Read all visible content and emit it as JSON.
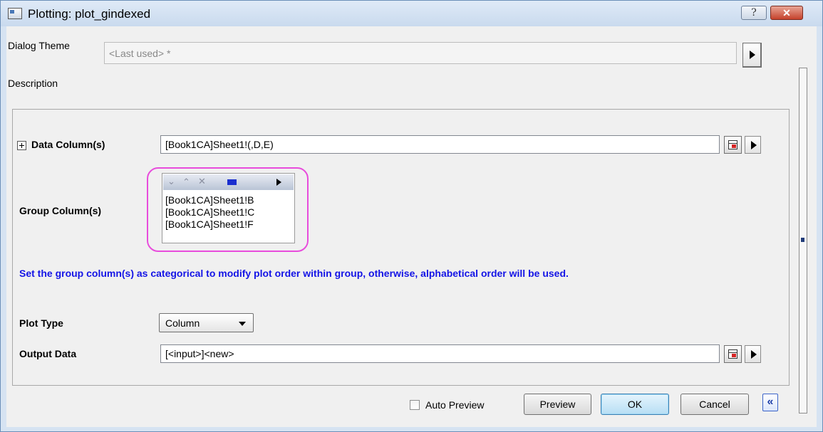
{
  "window": {
    "title": "Plotting: plot_gindexed",
    "help_symbol": "?",
    "close_symbol": "✕"
  },
  "dialog_theme": {
    "label": "Dialog Theme",
    "value": "<Last used> *"
  },
  "description": {
    "label": "Description"
  },
  "data_columns": {
    "label": "Data Column(s)",
    "value": "[Book1CA]Sheet1!(,D,E)"
  },
  "group_columns": {
    "label": "Group Column(s)",
    "toolbar_icons": [
      "move-down-icon",
      "move-up-icon",
      "delete-icon",
      "select-icon",
      "menu-arrow-icon"
    ],
    "items": [
      "[Book1CA]Sheet1!B",
      "[Book1CA]Sheet1!C",
      "[Book1CA]Sheet1!F"
    ]
  },
  "note": "Set the group column(s) as categorical to modify plot order within group, otherwise, alphabetical order will be used.",
  "plot_type": {
    "label": "Plot Type",
    "selected": "Column"
  },
  "output_data": {
    "label": "Output Data",
    "value": "[<input>]<new>"
  },
  "footer": {
    "auto_preview_label": "Auto Preview",
    "auto_preview_checked": false,
    "preview_label": "Preview",
    "ok_label": "OK",
    "cancel_label": "Cancel",
    "collapse_symbol": "«"
  },
  "colors": {
    "note_text": "#1414e6",
    "highlight_ring": "#e84cdc",
    "title_bar": "#c9daee",
    "close_button": "#c6422c"
  }
}
